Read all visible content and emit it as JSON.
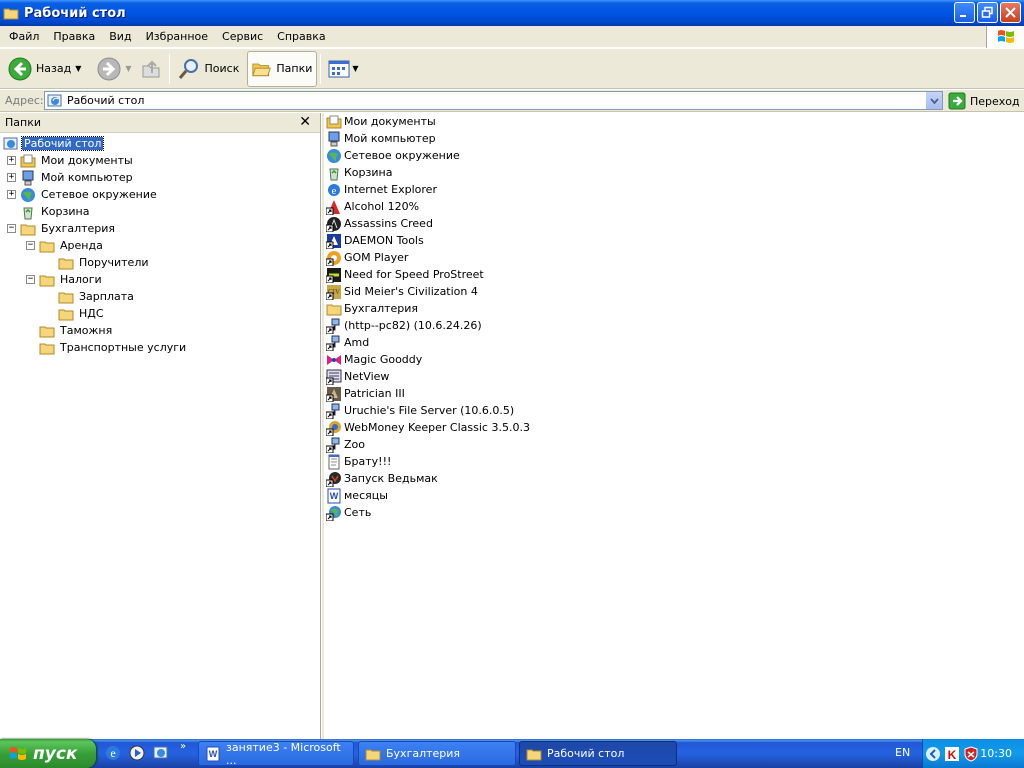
{
  "window": {
    "title": "Рабочий стол"
  },
  "menu": [
    "Файл",
    "Правка",
    "Вид",
    "Избранное",
    "Сервис",
    "Справка"
  ],
  "toolbar": {
    "back_label": "Назад",
    "search_label": "Поиск",
    "folders_label": "Папки"
  },
  "address": {
    "label": "Адрес:",
    "value": "Рабочий стол",
    "go_label": "Переход"
  },
  "folders_pane": {
    "title": "Папки",
    "tree": [
      {
        "label": "Рабочий стол",
        "icon": "desktop-icon"
      },
      {
        "label": "Мои документы",
        "icon": "my-documents-icon"
      },
      {
        "label": "Мой компьютер",
        "icon": "my-computer-icon"
      },
      {
        "label": "Сетевое окружение",
        "icon": "network-icon"
      },
      {
        "label": "Корзина",
        "icon": "recycle-bin-icon"
      },
      {
        "label": "Бухгалтерия",
        "icon": "folder-icon"
      },
      {
        "label": "Аренда",
        "icon": "folder-icon"
      },
      {
        "label": "Поручители",
        "icon": "folder-icon"
      },
      {
        "label": "Налоги",
        "icon": "folder-icon"
      },
      {
        "label": "Зарплата",
        "icon": "folder-icon"
      },
      {
        "label": "НДС",
        "icon": "folder-icon"
      },
      {
        "label": "Таможня",
        "icon": "folder-icon"
      },
      {
        "label": "Транспортные услуги",
        "icon": "folder-icon"
      }
    ]
  },
  "items": [
    {
      "label": "Мои документы",
      "icon": "my-documents-icon"
    },
    {
      "label": "Мой компьютер",
      "icon": "my-computer-icon"
    },
    {
      "label": "Сетевое окружение",
      "icon": "network-icon"
    },
    {
      "label": "Корзина",
      "icon": "recycle-bin-icon"
    },
    {
      "label": "Internet Explorer",
      "icon": "internet-explorer-icon"
    },
    {
      "label": "Alcohol 120%",
      "icon": "alcohol-icon"
    },
    {
      "label": "Assassins Creed",
      "icon": "assassins-creed-icon"
    },
    {
      "label": "DAEMON Tools",
      "icon": "daemon-tools-icon"
    },
    {
      "label": "GOM Player",
      "icon": "gom-player-icon"
    },
    {
      "label": "Need for Speed ProStreet",
      "icon": "nfs-icon"
    },
    {
      "label": "Sid Meier's Civilization 4",
      "icon": "civilization-icon"
    },
    {
      "label": "Бухгалтерия",
      "icon": "folder-icon"
    },
    {
      "label": "(http--pc82) (10.6.24.26)",
      "icon": "network-shortcut-icon"
    },
    {
      "label": "Amd",
      "icon": "network-shortcut-icon"
    },
    {
      "label": "Magic Gooddy",
      "icon": "magic-gooddy-icon"
    },
    {
      "label": "NetView",
      "icon": "netview-icon"
    },
    {
      "label": "Patrician III",
      "icon": "patrician-icon"
    },
    {
      "label": "Uruchie's File Server (10.6.0.5)",
      "icon": "network-shortcut-icon"
    },
    {
      "label": "WebMoney Keeper Classic 3.5.0.3",
      "icon": "webmoney-icon"
    },
    {
      "label": "Zoo",
      "icon": "network-shortcut-icon"
    },
    {
      "label": "Брату!!!",
      "icon": "notepad-icon"
    },
    {
      "label": "Запуск Ведьмак",
      "icon": "witcher-icon"
    },
    {
      "label": "месяцы",
      "icon": "word-document-icon"
    },
    {
      "label": "Сеть",
      "icon": "network-connections-icon"
    }
  ],
  "taskbar": {
    "start_label": "пуск",
    "tasks": [
      {
        "label": "занятие3 - Microsoft ...",
        "icon": "word-icon"
      },
      {
        "label": "Бухгалтерия",
        "icon": "folder-icon"
      },
      {
        "label": "Рабочий стол",
        "icon": "folder-icon"
      }
    ],
    "language": "EN",
    "clock": "10:30"
  }
}
